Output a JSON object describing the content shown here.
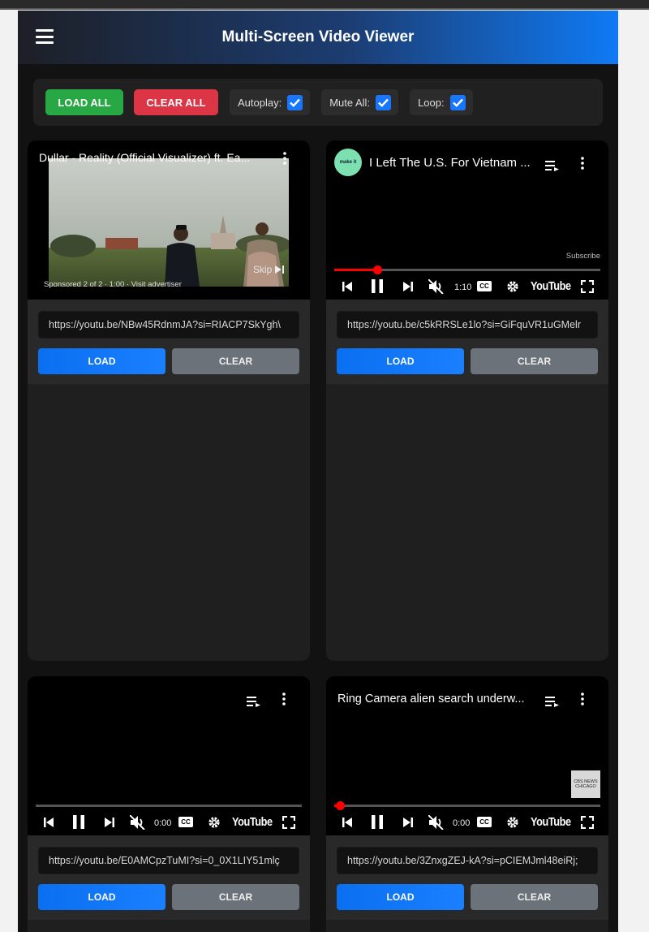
{
  "header": {
    "title": "Multi-Screen Video Viewer"
  },
  "controls": {
    "load_all": "LOAD ALL",
    "clear_all": "CLEAR ALL",
    "autoplay_label": "Autoplay:",
    "mute_label": "Mute All:",
    "loop_label": "Loop:",
    "autoplay": true,
    "mute": true,
    "loop": true
  },
  "players": [
    {
      "title": "Dullar - Reality (Official Visualizer) ft. Ea...",
      "ad_text": "Sponsored 2 of 2 · 1:00 · Visit advertiser",
      "skip": "Skip",
      "url": "https://youtu.be/NBw45RdnmJA?si=RIACP7SkYgh\\",
      "load": "LOAD",
      "clear": "CLEAR"
    },
    {
      "title": "I Left The U.S. For Vietnam ...",
      "channel_badge": "make it",
      "subscribe": "Subscribe",
      "time": "1:10",
      "progress": 0.15,
      "url": "https://youtu.be/c5kRRSLe1lo?si=GiFquVR1uGMelr",
      "load": "LOAD",
      "clear": "CLEAR"
    },
    {
      "title": "",
      "time": "0:00",
      "progress": 0,
      "url": "https://youtu.be/E0AMCpzTuMI?si=0_0X1LIY51mlç",
      "load": "LOAD",
      "clear": "CLEAR"
    },
    {
      "title": "Ring Camera alien search underw...",
      "watermark": "CBS NEWS CHICAGO",
      "time": "0:00",
      "progress": 0.01,
      "url": "https://youtu.be/3ZnxgZEJ-kA?si=pCIEMJml48eiRj;",
      "load": "LOAD",
      "clear": "CLEAR"
    }
  ],
  "youtube_label": "YouTube",
  "cc_label": "CC"
}
